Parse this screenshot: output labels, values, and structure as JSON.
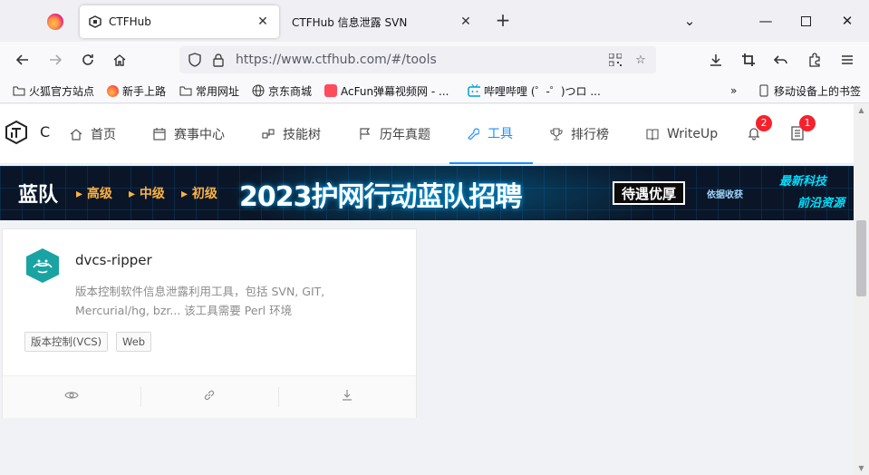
{
  "browser": {
    "tabs": [
      {
        "label": "CTFHub",
        "active": true
      },
      {
        "label": "CTFHub 信息泄露 SVN",
        "active": false
      }
    ],
    "url": "https://www.ctfhub.com/#/tools",
    "bookmarks": [
      {
        "label": "火狐官方站点",
        "icon": "firefox-icon"
      },
      {
        "label": "新手上路",
        "icon": "firefox-icon"
      },
      {
        "label": "常用网址",
        "icon": "folder-icon"
      },
      {
        "label": "京东商城",
        "icon": "globe-icon"
      },
      {
        "label": "AcFun弹幕视频网 - ...",
        "icon": "acfun-icon"
      },
      {
        "label": "哔哩哔哩 (゜-゜)つロ ...",
        "icon": "bilibili-icon"
      },
      {
        "label": "移动设备上的书签",
        "icon": "mobile-icon"
      }
    ]
  },
  "site": {
    "logo_text": "C",
    "menu": [
      {
        "label": "首页",
        "icon": "home-icon"
      },
      {
        "label": "赛事中心",
        "icon": "calendar-icon"
      },
      {
        "label": "技能树",
        "icon": "tree-icon"
      },
      {
        "label": "历年真题",
        "icon": "flag-icon"
      },
      {
        "label": "工具",
        "icon": "wrench-icon",
        "active": true
      },
      {
        "label": "排行榜",
        "icon": "trophy-icon"
      },
      {
        "label": "WriteUp",
        "icon": "book-icon"
      }
    ],
    "notifications_count": "2",
    "messages_count": "1"
  },
  "banner": {
    "left_title": "蓝队",
    "levels": [
      "高级",
      "中级",
      "初级"
    ],
    "headline": "2023护网行动蓝队招聘",
    "tag": "待遇优厚",
    "sub_tag": "依据收获",
    "right_tag_1": "最新科技",
    "right_tag_2": "前沿资源"
  },
  "tool_card": {
    "title": "dvcs-ripper",
    "description": "版本控制软件信息泄露利用工具，包括 SVN, GIT, Mercurial/hg, bzr... 该工具需要 Perl 环境",
    "tags": [
      "版本控制(VCS)",
      "Web"
    ]
  },
  "colors": {
    "accent": "#1890ff",
    "badge": "#f5222d",
    "tool_avatar": "#1aa3a3"
  }
}
